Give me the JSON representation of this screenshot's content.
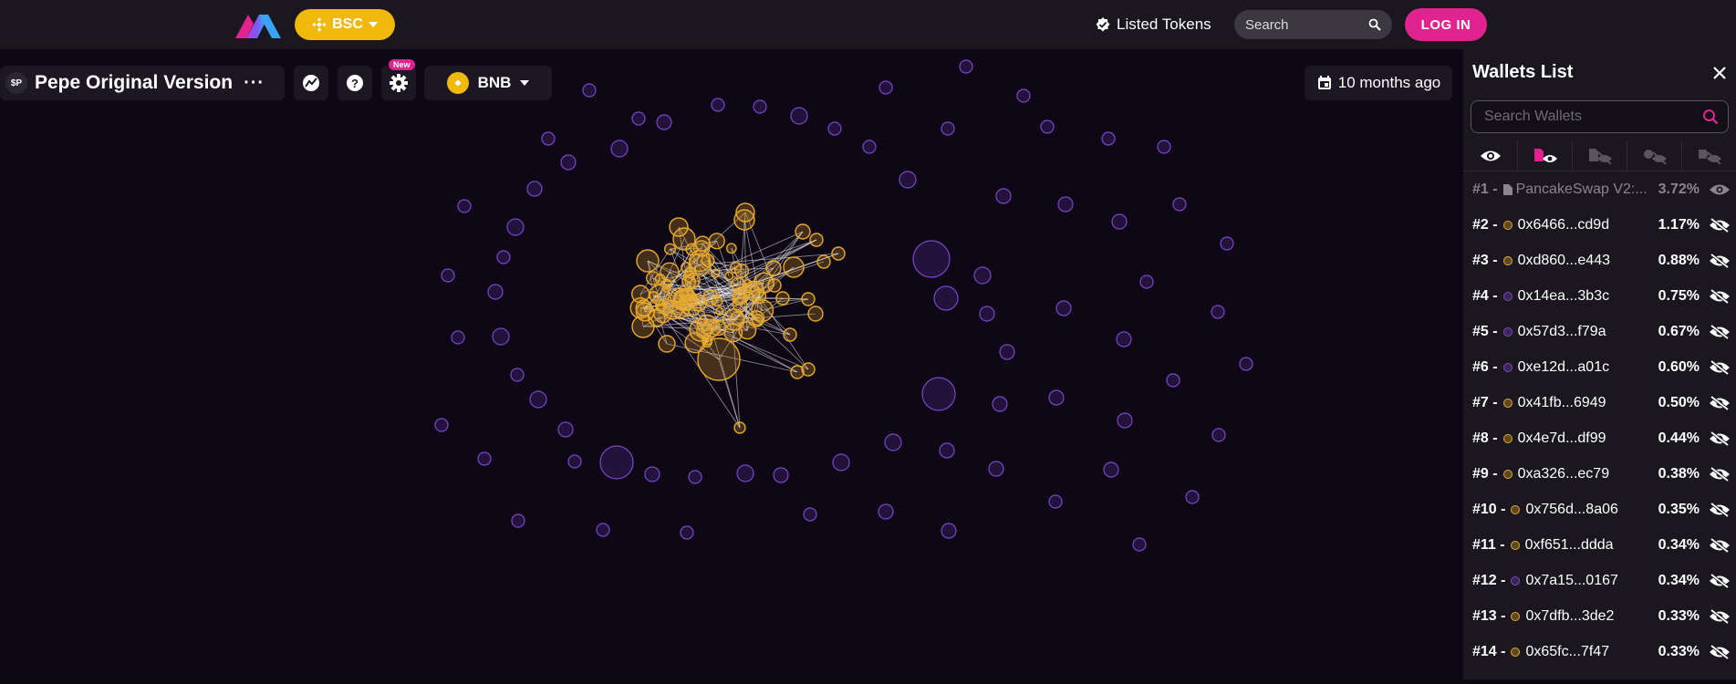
{
  "topbar": {
    "chain_label": "BSC",
    "listed_tokens_label": "Listed Tokens",
    "search_placeholder": "Search",
    "login_label": "LOG IN"
  },
  "toolbar": {
    "token_badge": "$P",
    "token_name": "Pepe Original Version",
    "more_label": "···",
    "new_tag": "New",
    "network_label": "BNB",
    "date_label": "10 months ago"
  },
  "wallet_panel": {
    "title": "Wallets List",
    "search_placeholder": "Search Wallets",
    "wallets": [
      {
        "rank": "#1 -",
        "address": "PancakeSwap V2:...",
        "percent": "3.72%",
        "color": "#8a8590",
        "type": "contract",
        "visible": true
      },
      {
        "rank": "#2 -",
        "address": "0x6466...cd9d",
        "percent": "1.17%",
        "color": "#e8a92a",
        "type": "wallet",
        "visible": false
      },
      {
        "rank": "#3 -",
        "address": "0xd860...e443",
        "percent": "0.88%",
        "color": "#e8a92a",
        "type": "wallet",
        "visible": false
      },
      {
        "rank": "#4 -",
        "address": "0x14ea...3b3c",
        "percent": "0.75%",
        "color": "#7a47c9",
        "type": "wallet",
        "visible": false
      },
      {
        "rank": "#5 -",
        "address": "0x57d3...f79a",
        "percent": "0.67%",
        "color": "#7a47c9",
        "type": "wallet",
        "visible": false
      },
      {
        "rank": "#6 -",
        "address": "0xe12d...a01c",
        "percent": "0.60%",
        "color": "#7a47c9",
        "type": "wallet",
        "visible": false
      },
      {
        "rank": "#7 -",
        "address": "0x41fb...6949",
        "percent": "0.50%",
        "color": "#e8a92a",
        "type": "wallet",
        "visible": false
      },
      {
        "rank": "#8 -",
        "address": "0x4e7d...df99",
        "percent": "0.44%",
        "color": "#e8a92a",
        "type": "wallet",
        "visible": false
      },
      {
        "rank": "#9 -",
        "address": "0xa326...ec79",
        "percent": "0.38%",
        "color": "#e8a92a",
        "type": "wallet",
        "visible": false
      },
      {
        "rank": "#10 -",
        "address": "0x756d...8a06",
        "percent": "0.35%",
        "color": "#e8a92a",
        "type": "wallet",
        "visible": false
      },
      {
        "rank": "#11 -",
        "address": "0xf651...ddda",
        "percent": "0.34%",
        "color": "#e8a92a",
        "type": "wallet",
        "visible": false
      },
      {
        "rank": "#12 -",
        "address": "0x7a15...0167",
        "percent": "0.34%",
        "color": "#7a47c9",
        "type": "wallet",
        "visible": false
      },
      {
        "rank": "#13 -",
        "address": "0x7dfb...3de2",
        "percent": "0.33%",
        "color": "#e8a92a",
        "type": "wallet",
        "visible": false
      },
      {
        "rank": "#14 -",
        "address": "0x65fc...7f47",
        "percent": "0.33%",
        "color": "#e8a92a",
        "type": "wallet",
        "visible": false
      }
    ]
  },
  "colors": {
    "accent": "#e0238e",
    "bsc_yellow": "#f0b90b",
    "cluster_node": "#e8a92a",
    "outer_node": "#7a47c9"
  }
}
